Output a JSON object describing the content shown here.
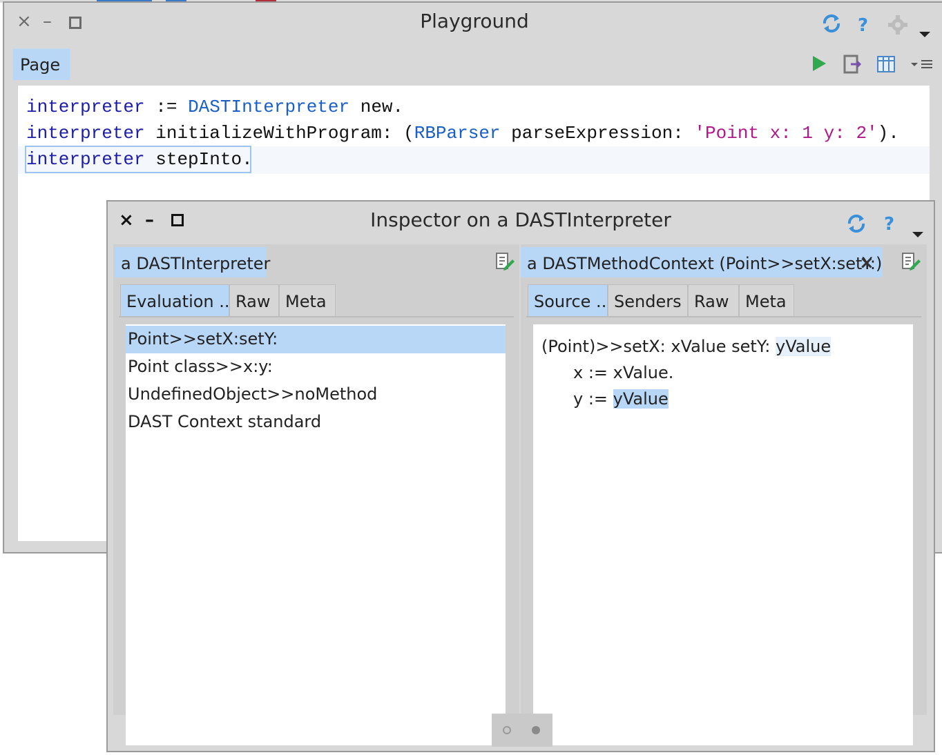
{
  "playground": {
    "title": "Playground",
    "tab_label": "Page",
    "code": {
      "line1": {
        "var": "interpreter",
        "op": " := ",
        "cls": "DASTInterpreter",
        "rest": " new."
      },
      "line2": {
        "var": "interpreter",
        "msg": " initializeWithProgram: (",
        "cls": "RBParser",
        "msg2": " parseExpression: ",
        "str": "'Point x: 1 y: 2'",
        "end": ")."
      },
      "line3": {
        "var": "interpreter",
        "rest": " stepInto."
      }
    }
  },
  "inspector": {
    "title": "Inspector on a DASTInterpreter",
    "left_pane": {
      "tab_label": "a DASTInterpreter",
      "subtabs": [
        "Evaluation ...",
        "Raw",
        "Meta"
      ],
      "items": [
        "Point>>setX:setY:",
        "Point class>>x:y:",
        "UndefinedObject>>noMethod",
        "DAST Context standard"
      ]
    },
    "right_pane": {
      "tab_label": "a DASTMethodContext (Point>>setX:setY:)",
      "close_glyph": "×",
      "subtabs": [
        "Source ...",
        "Senders",
        "Raw",
        "Meta"
      ],
      "source": {
        "line1_pre": "(Point)>>setX: xValue setY: ",
        "line1_hl": "yValue",
        "line2": "x := xValue.",
        "line3_pre": "y := ",
        "line3_hl": "yValue"
      }
    }
  },
  "window_controls": {
    "close": "×",
    "minimize": "–"
  },
  "icons": {
    "refresh": "refresh-icon",
    "help": "help-icon",
    "settings": "gear-icon",
    "menu": "chevron-down-icon",
    "run": "play-icon",
    "publish": "publish-icon",
    "bindings": "bindings-icon",
    "more": "more-menu-icon",
    "help_glyph": "?"
  },
  "colors": {
    "accent_blue": "#b8d6f5",
    "run_green": "#2fa84f",
    "icon_blue": "#3a8fd9"
  }
}
